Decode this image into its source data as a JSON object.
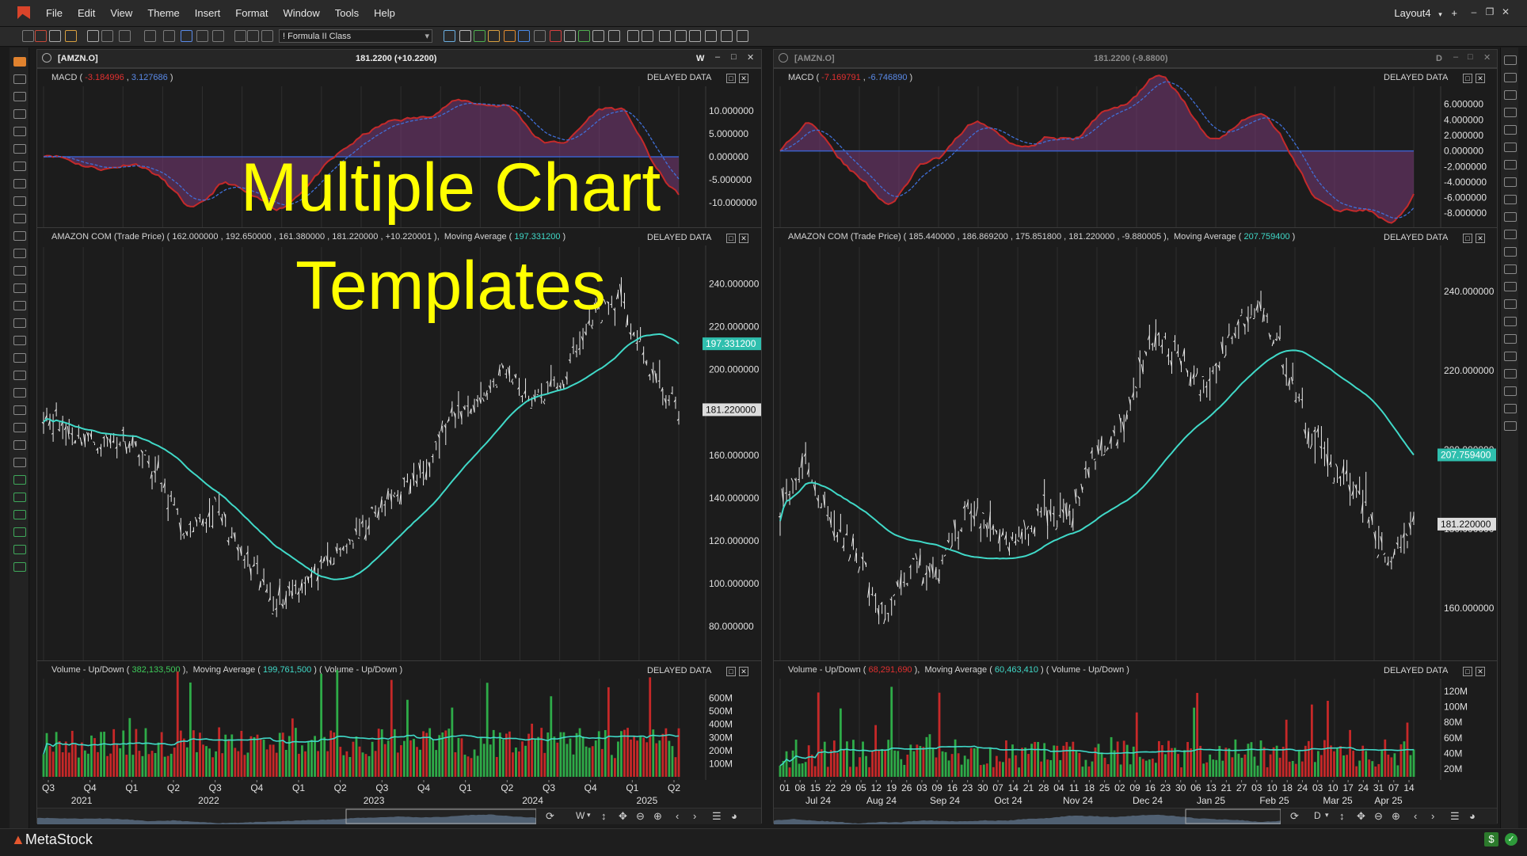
{
  "menu": {
    "items": [
      "File",
      "Edit",
      "View",
      "Theme",
      "Insert",
      "Format",
      "Window",
      "Tools",
      "Help"
    ],
    "layout_name": "Layout4",
    "layout_add": "+"
  },
  "toolbar": {
    "formula_select": "! Formula II Class"
  },
  "overlay": {
    "line1": "Multiple Chart",
    "line2": "Templates"
  },
  "colors": {
    "macd_line": "#c42a2a",
    "macd_signal": "#3f6fd8",
    "ma_line": "#40d9c8",
    "up_bar": "#2eab48",
    "down_bar": "#c62828",
    "overlay_text": "#ffff00",
    "zero_line": "#3a5fc8"
  },
  "chart1": {
    "symbol": "[AMZN.O]",
    "price": "181.2200 (+10.2200)",
    "period": "W",
    "macd": {
      "name": "MACD",
      "v1": "-3.184996",
      "v2": "3.127686",
      "axis": [
        "10.000000",
        "5.000000",
        "0.000000",
        "-5.000000",
        "-10.000000"
      ]
    },
    "price_pane": {
      "name": "AMAZON COM (Trade Price)",
      "o": "162.000000",
      "h": "192.650000",
      "l": "161.380000",
      "c": "181.220000",
      "chg": "+10.220001",
      "ma_label": "Moving Average",
      "ma_val": "197.331200",
      "axis": [
        "240.000000",
        "220.000000",
        "200.000000",
        "180.000000",
        "160.000000",
        "140.000000",
        "120.000000",
        "100.000000",
        "80.000000"
      ],
      "ma_tag": "197.331200",
      "last_tag": "181.220000"
    },
    "volume": {
      "name": "Volume - Up/Down",
      "v": "382,133,500",
      "ma_label": "Moving Average",
      "ma_val": "199,761,500",
      "suffix": "( Volume - Up/Down )",
      "axis": [
        "600M",
        "500M",
        "400M",
        "300M",
        "200M",
        "100M"
      ]
    },
    "x_ticks": [
      "Q3",
      "Q4",
      "Q1",
      "Q2",
      "Q3",
      "Q4",
      "Q1",
      "Q2",
      "Q3",
      "Q4",
      "Q1",
      "Q2",
      "Q3",
      "Q4",
      "Q1",
      "Q2"
    ],
    "x_years": [
      "2021",
      "2022",
      "2023",
      "2024",
      "2025"
    ],
    "nav_period": "W"
  },
  "chart2": {
    "symbol": "[AMZN.O]",
    "price": "181.2200 (-9.8800)",
    "period": "D",
    "macd": {
      "name": "MACD",
      "v1": "-7.169791",
      "v2": "-6.746890",
      "axis": [
        "6.000000",
        "4.000000",
        "2.000000",
        "0.000000",
        "-2.000000",
        "-4.000000",
        "-6.000000",
        "-8.000000"
      ]
    },
    "price_pane": {
      "name": "AMAZON COM (Trade Price)",
      "o": "185.440000",
      "h": "186.869200",
      "l": "175.851800",
      "c": "181.220000",
      "chg": "-9.880005",
      "ma_label": "Moving Average",
      "ma_val": "207.759400",
      "axis": [
        "240.000000",
        "220.000000",
        "200.000000",
        "180.000000",
        "160.000000"
      ],
      "ma_tag": "207.759400",
      "last_tag": "181.220000"
    },
    "volume": {
      "name": "Volume - Up/Down",
      "v": "68,291,690",
      "ma_label": "Moving Average",
      "ma_val": "60,463,410",
      "suffix": "( Volume - Up/Down )",
      "axis": [
        "120M",
        "100M",
        "80M",
        "60M",
        "40M",
        "20M"
      ]
    },
    "x_ticks": [
      "01",
      "08",
      "15",
      "22",
      "29",
      "05",
      "12",
      "19",
      "26",
      "03",
      "09",
      "16",
      "23",
      "30",
      "07",
      "14",
      "21",
      "28",
      "04",
      "11",
      "18",
      "25",
      "02",
      "09",
      "16",
      "23",
      "30",
      "06",
      "13",
      "21",
      "27",
      "03",
      "10",
      "18",
      "24",
      "03",
      "10",
      "17",
      "24",
      "31",
      "07",
      "14"
    ],
    "x_months": [
      "Jul 24",
      "Aug 24",
      "Sep 24",
      "Oct 24",
      "Nov 24",
      "Dec 24",
      "Jan 25",
      "Feb 25",
      "Mar 25",
      "Apr 25"
    ],
    "nav_period": "D"
  },
  "common": {
    "delayed": "DELAYED DATA"
  },
  "status": {
    "brand": "MetaStock",
    "dollar": "$"
  }
}
